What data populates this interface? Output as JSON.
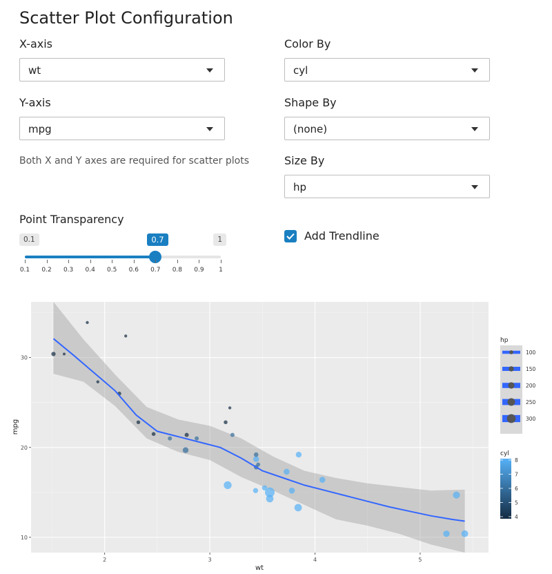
{
  "page": {
    "title": "Scatter Plot Configuration"
  },
  "controls": {
    "x_axis": {
      "label": "X-axis",
      "value": "wt"
    },
    "y_axis": {
      "label": "Y-axis",
      "value": "mpg"
    },
    "color_by": {
      "label": "Color By",
      "value": "cyl"
    },
    "shape_by": {
      "label": "Shape By",
      "value": "(none)"
    },
    "size_by": {
      "label": "Size By",
      "value": "hp"
    },
    "help_text": "Both X and Y axes are required for scatter plots",
    "transparency": {
      "label": "Point Transparency",
      "min": "0.1",
      "max": "1",
      "value": "0.7",
      "value_num": 0.7,
      "ticks": [
        "0.1",
        "0.2",
        "0.3",
        "0.4",
        "0.5",
        "0.6",
        "0.7",
        "0.8",
        "0.9",
        "1"
      ]
    },
    "trendline": {
      "label": "Add Trendline",
      "checked": true
    }
  },
  "chart_data": {
    "type": "scatter",
    "xlabel": "wt",
    "ylabel": "mpg",
    "xlim": [
      1.3,
      5.65
    ],
    "ylim": [
      8.3,
      36.2
    ],
    "x_ticks": [
      "2",
      "3",
      "4",
      "5"
    ],
    "y_ticks": [
      "10",
      "20",
      "30"
    ],
    "colors": {
      "low": "#132B43",
      "high": "#56B1F7",
      "trend": "#3366FF"
    },
    "points": [
      {
        "x": 2.62,
        "y": 21.0,
        "cyl": 6,
        "hp": 110
      },
      {
        "x": 2.875,
        "y": 21.0,
        "cyl": 6,
        "hp": 110
      },
      {
        "x": 2.32,
        "y": 22.8,
        "cyl": 4,
        "hp": 93
      },
      {
        "x": 3.215,
        "y": 21.4,
        "cyl": 6,
        "hp": 110
      },
      {
        "x": 3.44,
        "y": 18.7,
        "cyl": 8,
        "hp": 175
      },
      {
        "x": 3.46,
        "y": 18.1,
        "cyl": 6,
        "hp": 105
      },
      {
        "x": 3.57,
        "y": 14.3,
        "cyl": 8,
        "hp": 245
      },
      {
        "x": 3.19,
        "y": 24.4,
        "cyl": 4,
        "hp": 62
      },
      {
        "x": 3.15,
        "y": 22.8,
        "cyl": 4,
        "hp": 95
      },
      {
        "x": 3.44,
        "y": 19.2,
        "cyl": 6,
        "hp": 123
      },
      {
        "x": 3.44,
        "y": 17.8,
        "cyl": 6,
        "hp": 123
      },
      {
        "x": 4.07,
        "y": 16.4,
        "cyl": 8,
        "hp": 180
      },
      {
        "x": 3.73,
        "y": 17.3,
        "cyl": 8,
        "hp": 180
      },
      {
        "x": 3.78,
        "y": 15.2,
        "cyl": 8,
        "hp": 180
      },
      {
        "x": 5.25,
        "y": 10.4,
        "cyl": 8,
        "hp": 205
      },
      {
        "x": 5.424,
        "y": 10.4,
        "cyl": 8,
        "hp": 215
      },
      {
        "x": 5.345,
        "y": 14.7,
        "cyl": 8,
        "hp": 230
      },
      {
        "x": 2.2,
        "y": 32.4,
        "cyl": 4,
        "hp": 66
      },
      {
        "x": 1.615,
        "y": 30.4,
        "cyl": 4,
        "hp": 52
      },
      {
        "x": 1.835,
        "y": 33.9,
        "cyl": 4,
        "hp": 65
      },
      {
        "x": 2.465,
        "y": 21.5,
        "cyl": 4,
        "hp": 97
      },
      {
        "x": 3.52,
        "y": 15.5,
        "cyl": 8,
        "hp": 150
      },
      {
        "x": 3.435,
        "y": 15.2,
        "cyl": 8,
        "hp": 150
      },
      {
        "x": 3.84,
        "y": 13.3,
        "cyl": 8,
        "hp": 245
      },
      {
        "x": 3.845,
        "y": 19.2,
        "cyl": 8,
        "hp": 175
      },
      {
        "x": 1.935,
        "y": 27.3,
        "cyl": 4,
        "hp": 66
      },
      {
        "x": 2.14,
        "y": 26.0,
        "cyl": 4,
        "hp": 91
      },
      {
        "x": 1.513,
        "y": 30.4,
        "cyl": 4,
        "hp": 113
      },
      {
        "x": 3.17,
        "y": 15.8,
        "cyl": 8,
        "hp": 264
      },
      {
        "x": 2.77,
        "y": 19.7,
        "cyl": 6,
        "hp": 175
      },
      {
        "x": 3.57,
        "y": 15.0,
        "cyl": 8,
        "hp": 335
      },
      {
        "x": 2.78,
        "y": 21.4,
        "cyl": 4,
        "hp": 109
      }
    ],
    "trend": [
      {
        "x": 1.513,
        "y": 32.1
      },
      {
        "x": 1.7,
        "y": 30.3
      },
      {
        "x": 1.9,
        "y": 28.3
      },
      {
        "x": 2.1,
        "y": 26.3
      },
      {
        "x": 2.3,
        "y": 23.6
      },
      {
        "x": 2.5,
        "y": 21.8
      },
      {
        "x": 2.7,
        "y": 21.2
      },
      {
        "x": 2.9,
        "y": 20.6
      },
      {
        "x": 3.1,
        "y": 20.0
      },
      {
        "x": 3.3,
        "y": 18.8
      },
      {
        "x": 3.5,
        "y": 17.4
      },
      {
        "x": 3.7,
        "y": 16.6
      },
      {
        "x": 3.9,
        "y": 15.8
      },
      {
        "x": 4.1,
        "y": 15.2
      },
      {
        "x": 4.3,
        "y": 14.6
      },
      {
        "x": 4.5,
        "y": 14.0
      },
      {
        "x": 4.7,
        "y": 13.4
      },
      {
        "x": 4.9,
        "y": 12.9
      },
      {
        "x": 5.1,
        "y": 12.4
      },
      {
        "x": 5.3,
        "y": 12.0
      },
      {
        "x": 5.424,
        "y": 11.8
      }
    ],
    "band_upper": [
      {
        "x": 1.513,
        "y": 36.2
      },
      {
        "x": 1.8,
        "y": 32.0
      },
      {
        "x": 2.1,
        "y": 28.1
      },
      {
        "x": 2.4,
        "y": 24.5
      },
      {
        "x": 2.7,
        "y": 23.1
      },
      {
        "x": 3.0,
        "y": 22.4
      },
      {
        "x": 3.3,
        "y": 21.0
      },
      {
        "x": 3.6,
        "y": 19.0
      },
      {
        "x": 3.9,
        "y": 17.4
      },
      {
        "x": 4.2,
        "y": 16.6
      },
      {
        "x": 4.5,
        "y": 16.0
      },
      {
        "x": 4.8,
        "y": 15.6
      },
      {
        "x": 5.1,
        "y": 15.2
      },
      {
        "x": 5.424,
        "y": 15.3
      }
    ],
    "band_lower": [
      {
        "x": 1.513,
        "y": 28.2
      },
      {
        "x": 1.8,
        "y": 27.3
      },
      {
        "x": 2.1,
        "y": 24.6
      },
      {
        "x": 2.4,
        "y": 21.0
      },
      {
        "x": 2.7,
        "y": 19.5
      },
      {
        "x": 3.0,
        "y": 18.6
      },
      {
        "x": 3.3,
        "y": 16.7
      },
      {
        "x": 3.6,
        "y": 15.2
      },
      {
        "x": 3.9,
        "y": 13.6
      },
      {
        "x": 4.2,
        "y": 12.0
      },
      {
        "x": 4.5,
        "y": 11.3
      },
      {
        "x": 4.8,
        "y": 10.4
      },
      {
        "x": 5.1,
        "y": 9.2
      },
      {
        "x": 5.424,
        "y": 8.3
      }
    ],
    "legend_size": {
      "title": "hp",
      "labels": [
        "100",
        "150",
        "200",
        "250",
        "300"
      ],
      "values": [
        100,
        150,
        200,
        250,
        300
      ]
    },
    "legend_color": {
      "title": "cyl",
      "labels": [
        "8",
        "7",
        "6",
        "5",
        "4"
      ],
      "values": [
        8,
        7,
        6,
        5,
        4
      ]
    },
    "grid": true,
    "legend_position": "right"
  }
}
